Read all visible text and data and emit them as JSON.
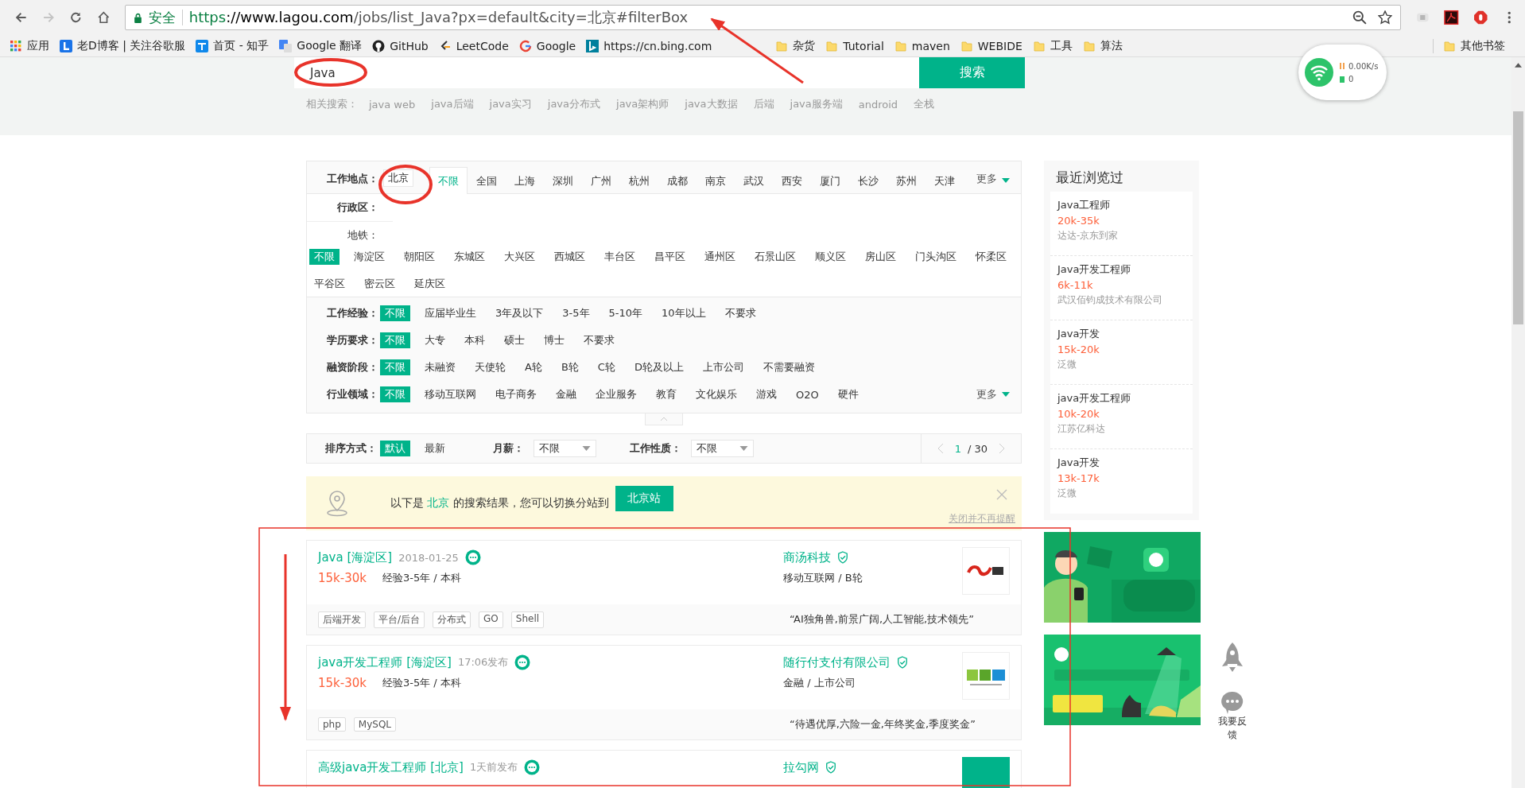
{
  "browser": {
    "forward_disabled": true,
    "secure_label": "安全",
    "url": {
      "scheme": "https",
      "host": "://www.lagou.com",
      "path": "/jobs/list_Java?px=default&city=北京#filterBox"
    },
    "bookmarks": [
      {
        "kind": "apps",
        "label": "应用"
      },
      {
        "kind": "blog",
        "label": "老D博客 | 关注谷歌服"
      },
      {
        "kind": "zhihu",
        "label": "首页 - 知乎"
      },
      {
        "kind": "translate",
        "label": "Google 翻译"
      },
      {
        "kind": "github",
        "label": "GitHub"
      },
      {
        "kind": "leetcode",
        "label": "LeetCode"
      },
      {
        "kind": "google",
        "label": "Google"
      },
      {
        "kind": "bing",
        "label": "https://cn.bing.com"
      },
      {
        "kind": "folder",
        "label": "杂货"
      },
      {
        "kind": "folder",
        "label": "Tutorial"
      },
      {
        "kind": "folder",
        "label": "maven"
      },
      {
        "kind": "folder",
        "label": "WEBIDE"
      },
      {
        "kind": "folder",
        "label": "工具"
      },
      {
        "kind": "folder",
        "label": "算法"
      }
    ],
    "other_bookmarks": "其他书签",
    "network_popup": {
      "speed": "0.00K/s",
      "count": "0"
    }
  },
  "search": {
    "value": "Java",
    "button": "搜索",
    "related_label": "相关搜索：",
    "related": [
      "java web",
      "java后端",
      "java实习",
      "java分布式",
      "java架构师",
      "java大数据",
      "后端",
      "java服务端",
      "android",
      "全栈"
    ]
  },
  "filters": {
    "city": {
      "label": "工作地点：",
      "current": "北京",
      "more": "更多",
      "options": [
        {
          "label": "不限",
          "selected": true
        },
        {
          "label": "全国",
          "selected": false
        },
        {
          "label": "上海",
          "selected": false
        },
        {
          "label": "深圳",
          "selected": false
        },
        {
          "label": "广州",
          "selected": false
        },
        {
          "label": "杭州",
          "selected": false
        },
        {
          "label": "成都",
          "selected": false
        },
        {
          "label": "南京",
          "selected": false
        },
        {
          "label": "武汉",
          "selected": false
        },
        {
          "label": "西安",
          "selected": false
        },
        {
          "label": "厦门",
          "selected": false
        },
        {
          "label": "长沙",
          "selected": false
        },
        {
          "label": "苏州",
          "selected": false
        },
        {
          "label": "天津",
          "selected": false
        }
      ]
    },
    "district_label": "行政区：",
    "subway_label": "地铁：",
    "districts": [
      {
        "label": "不限",
        "selected": true
      },
      {
        "label": "海淀区",
        "selected": false
      },
      {
        "label": "朝阳区",
        "selected": false
      },
      {
        "label": "东城区",
        "selected": false
      },
      {
        "label": "大兴区",
        "selected": false
      },
      {
        "label": "西城区",
        "selected": false
      },
      {
        "label": "丰台区",
        "selected": false
      },
      {
        "label": "昌平区",
        "selected": false
      },
      {
        "label": "通州区",
        "selected": false
      },
      {
        "label": "石景山区",
        "selected": false
      },
      {
        "label": "顺义区",
        "selected": false
      },
      {
        "label": "房山区",
        "selected": false
      },
      {
        "label": "门头沟区",
        "selected": false
      },
      {
        "label": "怀柔区",
        "selected": false
      },
      {
        "label": "平谷区",
        "selected": false
      },
      {
        "label": "密云区",
        "selected": false
      },
      {
        "label": "延庆区",
        "selected": false
      }
    ],
    "rows": [
      {
        "label": "工作经验：",
        "options": [
          {
            "label": "不限",
            "selected": true
          },
          {
            "label": "应届毕业生",
            "selected": false
          },
          {
            "label": "3年及以下",
            "selected": false
          },
          {
            "label": "3-5年",
            "selected": false
          },
          {
            "label": "5-10年",
            "selected": false
          },
          {
            "label": "10年以上",
            "selected": false
          },
          {
            "label": "不要求",
            "selected": false
          }
        ]
      },
      {
        "label": "学历要求：",
        "options": [
          {
            "label": "不限",
            "selected": true
          },
          {
            "label": "大专",
            "selected": false
          },
          {
            "label": "本科",
            "selected": false
          },
          {
            "label": "硕士",
            "selected": false
          },
          {
            "label": "博士",
            "selected": false
          },
          {
            "label": "不要求",
            "selected": false
          }
        ]
      },
      {
        "label": "融资阶段：",
        "options": [
          {
            "label": "不限",
            "selected": true
          },
          {
            "label": "未融资",
            "selected": false
          },
          {
            "label": "天使轮",
            "selected": false
          },
          {
            "label": "A轮",
            "selected": false
          },
          {
            "label": "B轮",
            "selected": false
          },
          {
            "label": "C轮",
            "selected": false
          },
          {
            "label": "D轮及以上",
            "selected": false
          },
          {
            "label": "上市公司",
            "selected": false
          },
          {
            "label": "不需要融资",
            "selected": false
          }
        ]
      },
      {
        "label": "行业领域：",
        "more": "更多",
        "options": [
          {
            "label": "不限",
            "selected": true
          },
          {
            "label": "移动互联网",
            "selected": false
          },
          {
            "label": "电子商务",
            "selected": false
          },
          {
            "label": "金融",
            "selected": false
          },
          {
            "label": "企业服务",
            "selected": false
          },
          {
            "label": "教育",
            "selected": false
          },
          {
            "label": "文化娱乐",
            "selected": false
          },
          {
            "label": "游戏",
            "selected": false
          },
          {
            "label": "O2O",
            "selected": false
          },
          {
            "label": "硬件",
            "selected": false
          }
        ]
      }
    ]
  },
  "sort_bar": {
    "label": "排序方式：",
    "options": [
      {
        "label": "默认",
        "selected": true
      },
      {
        "label": "最新",
        "selected": false
      }
    ],
    "salary_label": "月薪：",
    "salary_value": "不限",
    "nature_label": "工作性质：",
    "nature_value": "不限",
    "page": "1",
    "total": "/ 30"
  },
  "notice": {
    "prefix": "以下是 ",
    "city": "北京",
    "suffix": " 的搜索结果，您可以切换分站到",
    "button": "北京站",
    "dismiss": "关闭并不再提醒"
  },
  "jobs": [
    {
      "title": "Java [海淀区]",
      "date": "2018-01-25",
      "salary": "15k-30k",
      "requirement": "经验3-5年 / 本科",
      "company": "商汤科技",
      "company_info": "移动互联网 / B轮",
      "tags": [
        "后端开发",
        "平台/后台",
        "分布式",
        "GO",
        "Shell"
      ],
      "slogan": "“AI独角兽,前景广阔,人工智能,技术领先”",
      "logo": {
        "kind": "swirl"
      }
    },
    {
      "title": "java开发工程师 [海淀区]",
      "date": "17:06发布",
      "salary": "15k-30k",
      "requirement": "经验3-5年 / 本科",
      "company": "随行付支付有限公司",
      "company_info": "金融 / 上市公司",
      "tags": [
        "php",
        "MySQL"
      ],
      "slogan": "“待遇优厚,六险一金,年终奖金,季度奖金”",
      "logo": {
        "kind": "wordmark"
      }
    },
    {
      "title": "高级java开发工程师 [北京]",
      "date": "1天前发布",
      "company": "拉勾网",
      "logo": {
        "kind": "green"
      }
    }
  ],
  "recent": {
    "title": "最近浏览过",
    "items": [
      {
        "title": "Java工程师",
        "salary": "20k-35k",
        "company": "达达-京东到家"
      },
      {
        "title": "Java开发工程师",
        "salary": "6k-11k",
        "company": "武汉佰钧成技术有限公司"
      },
      {
        "title": "Java开发",
        "salary": "15k-20k",
        "company": "泛微"
      },
      {
        "title": "java开发工程师",
        "salary": "10k-20k",
        "company": "江苏亿科达"
      },
      {
        "title": "Java开发",
        "salary": "13k-17k",
        "company": "泛微"
      }
    ]
  },
  "feedback": "我要反馈"
}
